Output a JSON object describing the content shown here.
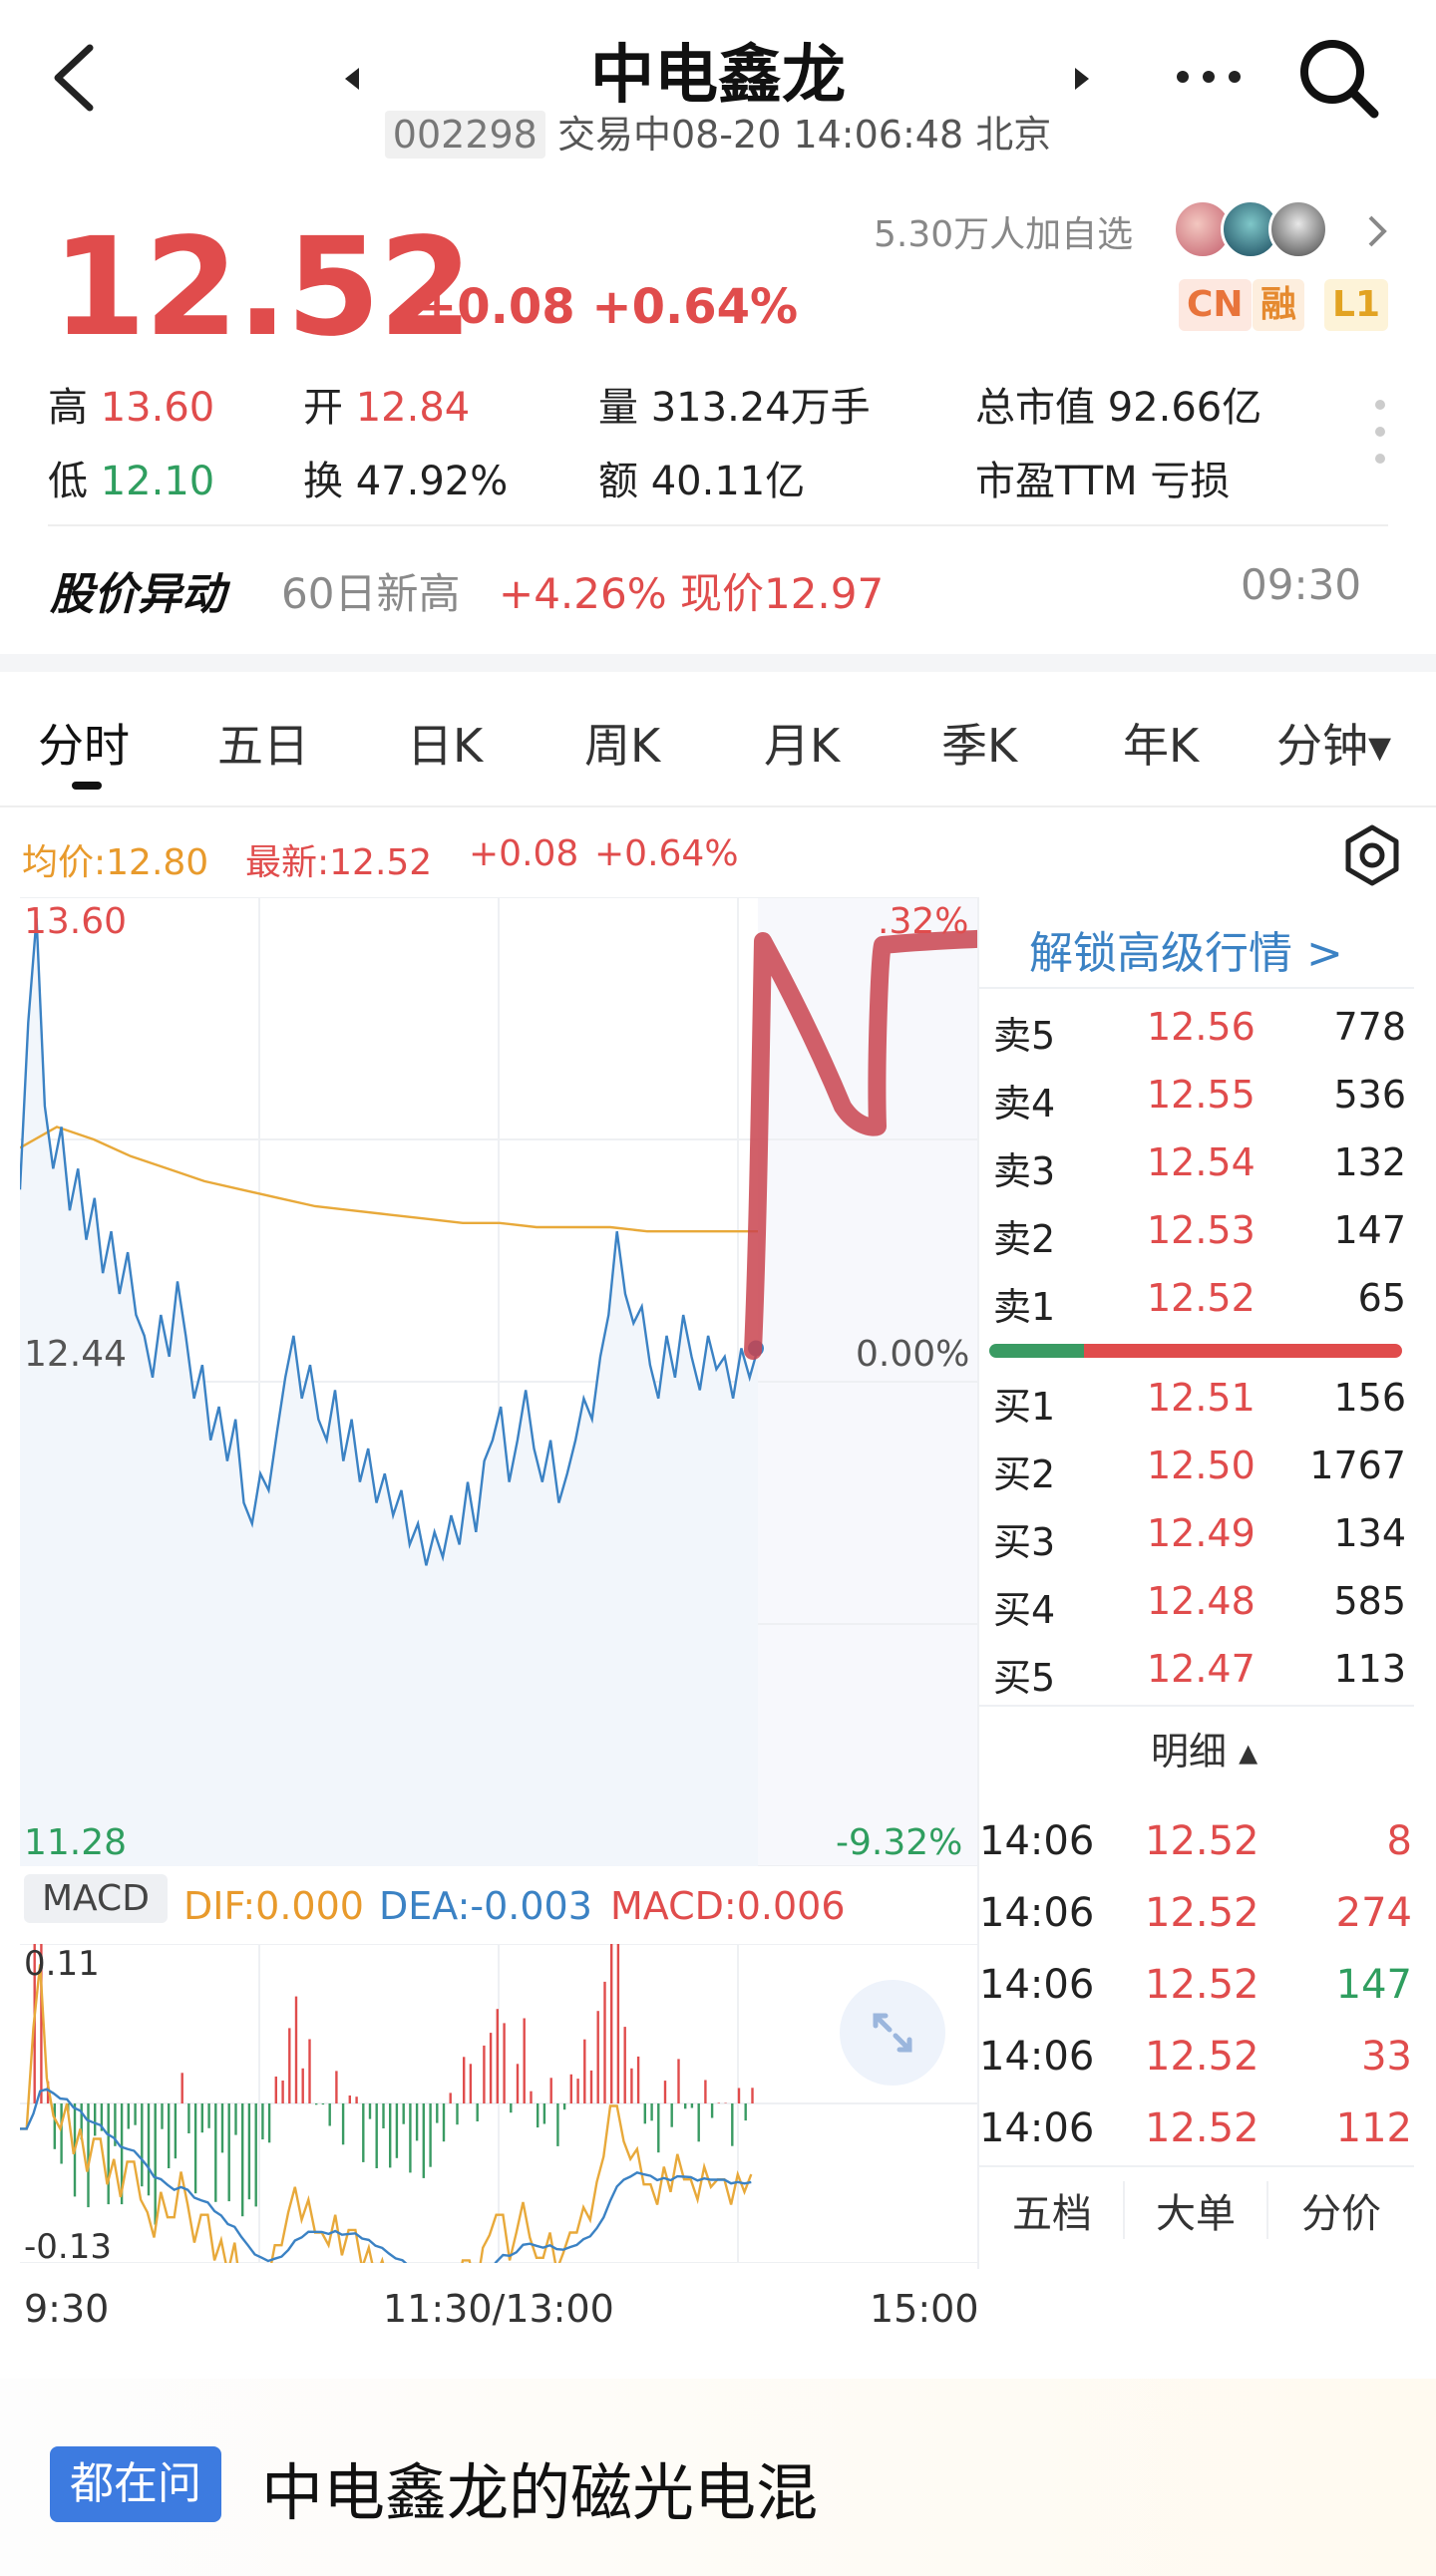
{
  "header": {
    "title": "中电鑫龙",
    "code": "002298",
    "status_time": "交易中08-20 14:06:48 北京"
  },
  "quote": {
    "price": "12.52",
    "change": "+0.08 +0.64%",
    "followers": "5.30万人加自选",
    "tags": [
      "CN",
      "融",
      "L1"
    ]
  },
  "stats": {
    "high_label": "高",
    "high": "13.60",
    "low_label": "低",
    "low": "12.10",
    "open_label": "开",
    "open": "12.84",
    "turnover_label": "换",
    "turnover": "47.92%",
    "volume_label": "量",
    "volume": "313.24万手",
    "amount_label": "额",
    "amount": "40.11亿",
    "mcap_label": "总市值",
    "mcap": "92.66亿",
    "pe_label": "市盈TTM",
    "pe": "亏损"
  },
  "alert": {
    "label": "股价异动",
    "text1": "60日新高",
    "text2": "+4.26% 现价12.97",
    "time": "09:30"
  },
  "tabs": [
    "分时",
    "五日",
    "日K",
    "周K",
    "月K",
    "季K",
    "年K",
    "分钟▾"
  ],
  "chart_info": {
    "avg": "均价:12.80",
    "latest": "最新:12.52",
    "chg": "+0.08",
    "pct": "+0.64%"
  },
  "axis": {
    "top": "13.60",
    "mid": "12.44",
    "bottom": "11.28",
    "top_pct": ".32%",
    "mid_pct": "0.00%",
    "bottom_pct": "-9.32%",
    "t_start": "9:30",
    "t_mid": "11:30/13:00",
    "t_end": "15:00"
  },
  "macd": {
    "label": "MACD",
    "dif": "DIF:0.000",
    "dea": "DEA:-0.003",
    "macd": "MACD:0.006",
    "top": "0.11",
    "bottom": "-0.13"
  },
  "orderbook": {
    "unlock": "解锁高级行情 >",
    "asks": [
      {
        "k": "卖5",
        "p": "12.56",
        "v": "778"
      },
      {
        "k": "卖4",
        "p": "12.55",
        "v": "536"
      },
      {
        "k": "卖3",
        "p": "12.54",
        "v": "132"
      },
      {
        "k": "卖2",
        "p": "12.53",
        "v": "147"
      },
      {
        "k": "卖1",
        "p": "12.52",
        "v": "65"
      }
    ],
    "bids": [
      {
        "k": "买1",
        "p": "12.51",
        "v": "156"
      },
      {
        "k": "买2",
        "p": "12.50",
        "v": "1767"
      },
      {
        "k": "买3",
        "p": "12.49",
        "v": "134"
      },
      {
        "k": "买4",
        "p": "12.48",
        "v": "585"
      },
      {
        "k": "买5",
        "p": "12.47",
        "v": "113"
      }
    ],
    "detail_label": "明细 ▴",
    "tape": [
      {
        "t": "14:06",
        "p": "12.52",
        "v": "8",
        "side": "red"
      },
      {
        "t": "14:06",
        "p": "12.52",
        "v": "274",
        "side": "red"
      },
      {
        "t": "14:06",
        "p": "12.52",
        "v": "147",
        "side": "green"
      },
      {
        "t": "14:06",
        "p": "12.52",
        "v": "33",
        "side": "red"
      },
      {
        "t": "14:06",
        "p": "12.52",
        "v": "112",
        "side": "red"
      }
    ],
    "bottom_tabs": [
      "五档",
      "大单",
      "分价"
    ]
  },
  "ask_card": {
    "badge": "都在问",
    "text": "中电鑫龙的磁光电混"
  },
  "colors": {
    "up": "#e04c4c",
    "down": "#2f9e5f",
    "avg": "#e89a2c",
    "line": "#3b82c4"
  },
  "chart_data": {
    "type": "line",
    "ylim": [
      11.28,
      13.6
    ],
    "reference": 12.44,
    "series": [
      {
        "values": [
          12.9,
          13.3,
          13.55,
          13.1,
          12.95,
          13.05,
          12.85,
          12.95,
          12.78,
          12.88,
          12.7,
          12.8,
          12.65,
          12.75,
          12.6,
          12.55,
          12.45,
          12.6,
          12.5,
          12.68,
          12.55,
          12.4,
          12.48,
          12.3,
          12.38,
          12.25,
          12.35,
          12.15,
          12.1,
          12.22,
          12.18,
          12.32,
          12.45,
          12.55,
          12.4,
          12.48,
          12.35,
          12.3,
          12.42,
          12.25,
          12.35,
          12.2,
          12.28,
          12.15,
          12.22,
          12.12,
          12.18,
          12.05,
          12.1,
          12.0,
          12.08,
          12.02,
          12.12,
          12.05,
          12.2,
          12.08,
          12.25,
          12.3,
          12.38,
          12.2,
          12.3,
          12.42,
          12.28,
          12.2,
          12.3,
          12.15,
          12.22,
          12.3,
          12.4,
          12.35,
          12.5,
          12.6,
          12.8,
          12.65,
          12.58,
          12.62,
          12.48,
          12.4,
          12.55,
          12.45,
          12.6,
          12.5,
          12.42,
          12.55,
          12.47,
          12.5,
          12.4,
          12.52,
          12.45,
          12.52
        ]
      },
      {
        "values": [
          13.0,
          13.05,
          13.02,
          12.98,
          12.95,
          12.92,
          12.9,
          12.88,
          12.86,
          12.85,
          12.84,
          12.83,
          12.82,
          12.82,
          12.81,
          12.81,
          12.81,
          12.8,
          12.8,
          12.8,
          12.8
        ]
      }
    ]
  }
}
